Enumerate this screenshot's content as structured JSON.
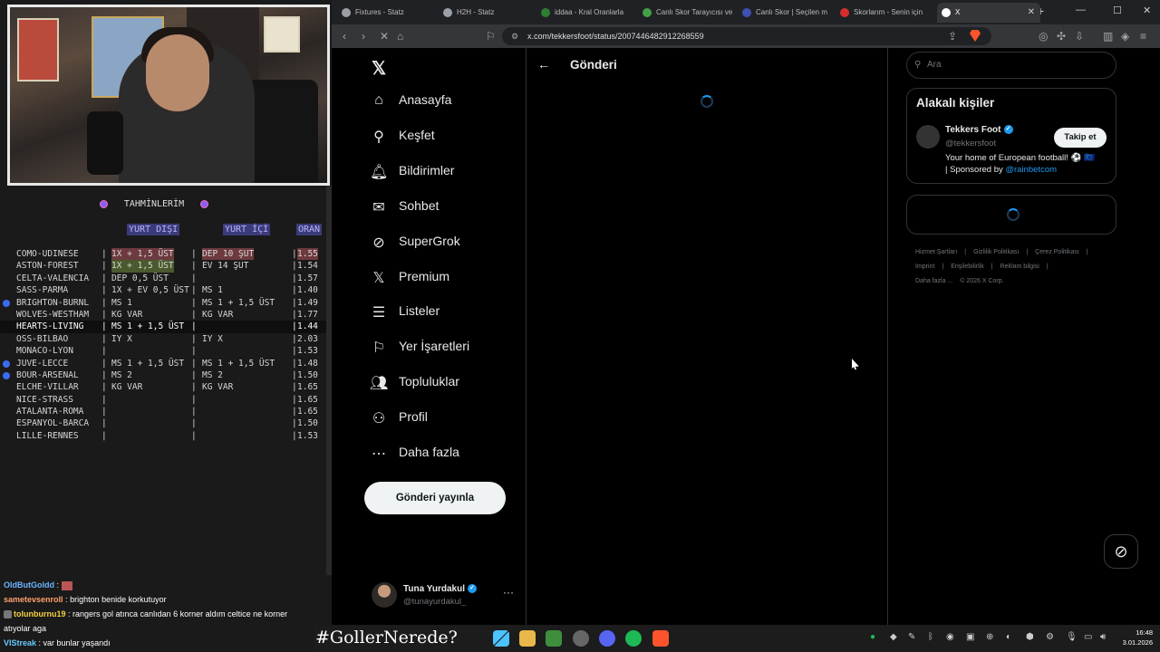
{
  "overlay": {
    "title": "TAHMİNLERİM",
    "headers": {
      "away": "YURT DIŞI",
      "home": "YURT İÇİ",
      "odds": "ORAN"
    },
    "rows": [
      {
        "match": "COMO-UDINESE",
        "away": "1X + 1,5 ÜST",
        "home": "DEP 10 ŞUT",
        "odds": "1.55",
        "bullet": false,
        "hl": false,
        "mark": "red"
      },
      {
        "match": "ASTON-FOREST",
        "away": "1X + 1,5 ÜST",
        "home": "EV 14 ŞUT",
        "odds": "1.54",
        "bullet": false,
        "hl": false,
        "mark": "grn"
      },
      {
        "match": "CELTA-VALENCIA",
        "away": "DEP 0,5 ÜST",
        "home": "",
        "odds": "1.57",
        "bullet": false,
        "hl": false,
        "mark": ""
      },
      {
        "match": "SASS-PARMA",
        "away": "1X + EV 0,5 ÜST",
        "home": "MS 1",
        "odds": "1.40",
        "bullet": false,
        "hl": false,
        "mark": ""
      },
      {
        "match": "BRIGHTON-BURNL",
        "away": "MS 1",
        "home": "MS 1 + 1,5 ÜST",
        "odds": "1.49",
        "bullet": true,
        "hl": false,
        "mark": ""
      },
      {
        "match": "WOLVES-WESTHAM",
        "away": "KG VAR",
        "home": "KG VAR",
        "odds": "1.77",
        "bullet": false,
        "hl": false,
        "mark": ""
      },
      {
        "match": "HEARTS-LIVING",
        "away": "MS 1 + 1,5 ÜST",
        "home": "",
        "odds": "1.44",
        "bullet": false,
        "hl": true,
        "mark": ""
      },
      {
        "match": "OSS-BILBAO",
        "away": "IY X",
        "home": "IY X",
        "odds": "2.03",
        "bullet": false,
        "hl": false,
        "mark": ""
      },
      {
        "match": "MONACO-LYON",
        "away": "",
        "home": "",
        "odds": "1.53",
        "bullet": false,
        "hl": false,
        "mark": ""
      },
      {
        "match": "JUVE-LECCE",
        "away": "MS 1 + 1,5 ÜST",
        "home": "MS 1 + 1,5 ÜST",
        "odds": "1.48",
        "bullet": true,
        "hl": false,
        "mark": ""
      },
      {
        "match": "BOUR-ARSENAL",
        "away": "MS 2",
        "home": "MS 2",
        "odds": "1.50",
        "bullet": true,
        "hl": false,
        "mark": ""
      },
      {
        "match": "ELCHE-VILLAR",
        "away": "KG VAR",
        "home": "KG VAR",
        "odds": "1.65",
        "bullet": false,
        "hl": false,
        "mark": ""
      },
      {
        "match": "NICE-STRASS",
        "away": "",
        "home": "",
        "odds": "1.65",
        "bullet": false,
        "hl": false,
        "mark": ""
      },
      {
        "match": "ATALANTA-ROMA",
        "away": "",
        "home": "",
        "odds": "1.65",
        "bullet": false,
        "hl": false,
        "mark": ""
      },
      {
        "match": "ESPANYOL-BARCA",
        "away": "",
        "home": "",
        "odds": "1.50",
        "bullet": false,
        "hl": false,
        "mark": ""
      },
      {
        "match": "LILLE-RENNES",
        "away": "",
        "home": "",
        "odds": "1.53",
        "bullet": false,
        "hl": false,
        "mark": ""
      }
    ]
  },
  "chat": [
    {
      "user": "OldButGoldd",
      "text": "",
      "emote": true,
      "cls": "u1"
    },
    {
      "user": "sametevsenroll",
      "text": "brighton benide korkutuyor",
      "emote": false,
      "cls": "u2"
    },
    {
      "user": "tolunburnu19",
      "text": "rangers gol atınca canlıdan 6 korner aldım celtice ne korner",
      "emote": false,
      "cls": "u3"
    },
    {
      "user": "",
      "text": "atıyolar aga",
      "emote": false,
      "cls": ""
    },
    {
      "user": "VIStreak",
      "text": "var bunlar yaşandı",
      "emote": false,
      "cls": "u4"
    }
  ],
  "browser": {
    "tabs": [
      {
        "label": "Fixtures - Statz",
        "color": "#9aa0a6"
      },
      {
        "label": "H2H - Statz",
        "color": "#9aa0a6"
      },
      {
        "label": "iddaa - Kral Oranlarla",
        "color": "#2e7d32"
      },
      {
        "label": "Canlı Skor Tarayıcısı ve",
        "color": "#43a047"
      },
      {
        "label": "Canlı Skor | Seçilen m",
        "color": "#3f51b5"
      },
      {
        "label": "Skorlarım - Senin için",
        "color": "#d32f2f"
      },
      {
        "label": "X",
        "color": "#ffffff"
      }
    ],
    "url": "x.com/tekkersfoot/status/2007446482912268559"
  },
  "x": {
    "nav": [
      {
        "label": "Anasayfa",
        "icon": "⌂",
        "name": "home"
      },
      {
        "label": "Keşfet",
        "icon": "⚲",
        "name": "explore"
      },
      {
        "label": "Bildirimler",
        "icon": "🔔︎",
        "name": "notifications"
      },
      {
        "label": "Sohbet",
        "icon": "✉",
        "name": "chat"
      },
      {
        "label": "SuperGrok",
        "icon": "⊘",
        "name": "supergrok"
      },
      {
        "label": "Premium",
        "icon": "𝕏",
        "name": "premium"
      },
      {
        "label": "Listeler",
        "icon": "☰",
        "name": "lists"
      },
      {
        "label": "Yer İşaretleri",
        "icon": "⚐",
        "name": "bookmarks"
      },
      {
        "label": "Topluluklar",
        "icon": "👥︎",
        "name": "communities"
      },
      {
        "label": "Profil",
        "icon": "⚇",
        "name": "profile"
      },
      {
        "label": "Daha fazla",
        "icon": "⋯",
        "name": "more"
      }
    ],
    "post_button": "Gönderi yayınla",
    "user": {
      "name": "Tuna Yurdakul",
      "handle": "@tunayurdakul_"
    },
    "page_title": "Gönderi",
    "search_placeholder": "Ara",
    "related": {
      "title": "Alakalı kişiler",
      "name": "Tekkers Foot",
      "handle": "@tekkersfoot",
      "follow": "Takip et",
      "bio": "Your home of European football! ⚽ 🇪🇺",
      "bio2": "| Sponsored by ",
      "bio_link": "@rainbetcom"
    },
    "footer": [
      "Hizmet Şartları",
      "|",
      "Gizlilik Politikası",
      "|",
      "Çerez Politikası",
      "|",
      "Imprint",
      "|",
      "Erişilebilirlik",
      "|",
      "Reklam bilgisi",
      "|",
      "Daha fazla ...",
      "© 2026 X Corp."
    ]
  },
  "taskbar": {
    "hashtag": "#GollerNerede?",
    "time": "16:48",
    "date": "3.01.2026"
  }
}
